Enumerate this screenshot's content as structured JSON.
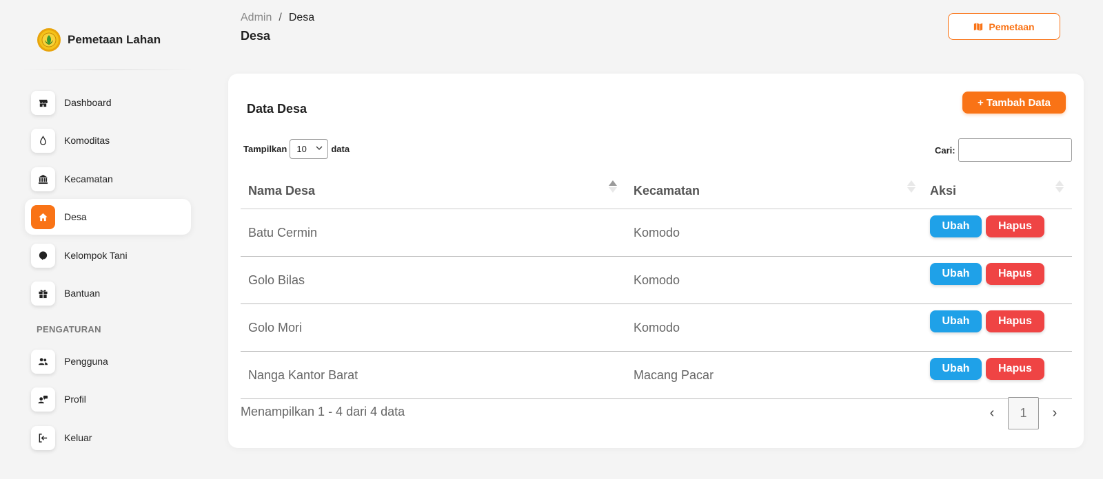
{
  "brand": {
    "title": "Pemetaan Lahan"
  },
  "sidebar": {
    "items": [
      {
        "label": "Dashboard",
        "icon": "store-icon"
      },
      {
        "label": "Komoditas",
        "icon": "drop-icon"
      },
      {
        "label": "Kecamatan",
        "icon": "bank-icon"
      },
      {
        "label": "Desa",
        "icon": "home-icon",
        "active": true
      },
      {
        "label": "Kelompok Tani",
        "icon": "leaf-icon"
      },
      {
        "label": "Bantuan",
        "icon": "gift-icon"
      }
    ],
    "section_label": "PENGATURAN",
    "settings": [
      {
        "label": "Pengguna",
        "icon": "users-icon"
      },
      {
        "label": "Profil",
        "icon": "profile-icon"
      },
      {
        "label": "Keluar",
        "icon": "logout-icon"
      }
    ]
  },
  "header": {
    "breadcrumb": [
      "Admin",
      "/",
      "Desa"
    ],
    "title": "Desa",
    "pemetaan_label": "Pemetaan"
  },
  "card": {
    "title": "Data Desa",
    "add_label": "+ Tambah Data",
    "length_label_before": "Tampilkan",
    "length_value": "10",
    "length_label_after": "data",
    "search_label": "Cari:",
    "search_value": "",
    "columns": [
      "Nama Desa",
      "Kecamatan",
      "Aksi"
    ],
    "rows": [
      {
        "nama": "Batu Cermin",
        "kecamatan": "Komodo"
      },
      {
        "nama": "Golo Bilas",
        "kecamatan": "Komodo"
      },
      {
        "nama": "Golo Mori",
        "kecamatan": "Komodo"
      },
      {
        "nama": "Nanga Kantor Barat",
        "kecamatan": "Macang Pacar"
      }
    ],
    "edit_label": "Ubah",
    "delete_label": "Hapus",
    "info": "Menampilkan 1 - 4 dari 4 data",
    "pager": {
      "prev": "‹",
      "current": "1",
      "next": "›"
    }
  },
  "colors": {
    "accent": "#f97316",
    "edit": "#1fa1e8",
    "delete": "#ef4444"
  }
}
